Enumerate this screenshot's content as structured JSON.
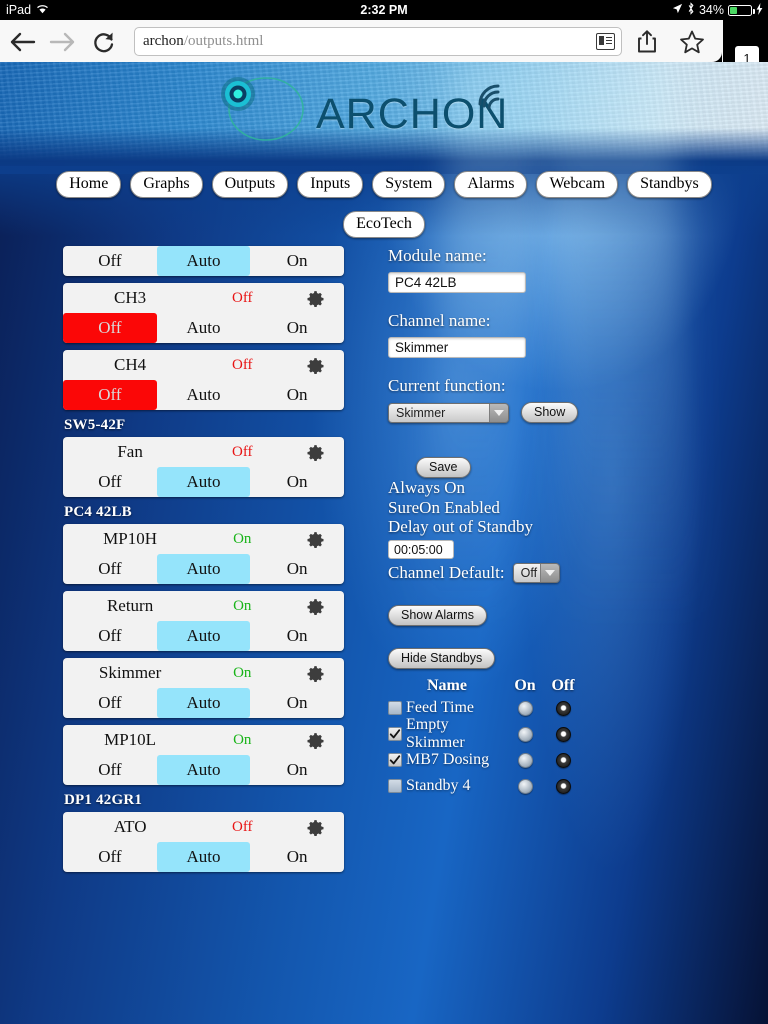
{
  "status_bar": {
    "device": "iPad",
    "wifi_icon": "wifi-icon",
    "time": "2:32 PM",
    "location_icon": "location-arrow-icon",
    "bluetooth_icon": "bluetooth-icon",
    "battery_percent": "34%",
    "battery_fill": 34,
    "charging_icon": "lightning-bolt-icon"
  },
  "browser": {
    "back_icon": "back-arrow-icon",
    "forward_icon": "forward-arrow-icon",
    "reload_icon": "reload-icon",
    "url_host": "archon",
    "url_path": "/outputs.html",
    "reader_icon": "reader-view-icon",
    "share_icon": "share-icon",
    "bookmark_icon": "star-icon",
    "tab_count": "1"
  },
  "header": {
    "logo_text": "ARCHON",
    "logo_mark": "archon-circle-logo-icon",
    "signal_icon": "wifi-arc-icon"
  },
  "nav": {
    "row1": [
      "Home",
      "Graphs",
      "Outputs",
      "Inputs",
      "System",
      "Alarms",
      "Webcam",
      "Standbys"
    ],
    "row2": [
      "EcoTech"
    ]
  },
  "button_labels": {
    "off": "Off",
    "auto": "Auto",
    "on": "On"
  },
  "channels": [
    {
      "group": null,
      "clipped": true,
      "name": "",
      "state": "",
      "state_kind": "",
      "selected": "auto"
    },
    {
      "group": null,
      "clipped": false,
      "name": "CH3",
      "state": "Off",
      "state_kind": "off",
      "selected": "off"
    },
    {
      "group": null,
      "clipped": false,
      "name": "CH4",
      "state": "Off",
      "state_kind": "off",
      "selected": "off"
    },
    {
      "group": "SW5-42F",
      "clipped": false,
      "name": "Fan",
      "state": "Off",
      "state_kind": "off",
      "selected": "auto"
    },
    {
      "group": "PC4 42LB",
      "clipped": false,
      "name": "MP10H",
      "state": "On",
      "state_kind": "on",
      "selected": "auto"
    },
    {
      "group": null,
      "clipped": false,
      "name": "Return",
      "state": "On",
      "state_kind": "on",
      "selected": "auto"
    },
    {
      "group": null,
      "clipped": false,
      "name": "Skimmer",
      "state": "On",
      "state_kind": "on",
      "selected": "auto"
    },
    {
      "group": null,
      "clipped": false,
      "name": "MP10L",
      "state": "On",
      "state_kind": "on",
      "selected": "auto"
    },
    {
      "group": "DP1 42GR1",
      "clipped": false,
      "name": "ATO",
      "state": "Off",
      "state_kind": "off",
      "selected": "auto"
    }
  ],
  "form": {
    "module_name_label": "Module name:",
    "module_name_value": "PC4 42LB",
    "channel_name_label": "Channel name:",
    "channel_name_value": "Skimmer",
    "current_function_label": "Current function:",
    "current_function_value": "Skimmer",
    "show_button": "Show",
    "save_button": "Save",
    "always_on": "Always On",
    "sureon_enabled": "SureOn Enabled",
    "delay_out_of_standby": "Delay out of Standby",
    "delay_value": "00:05:00",
    "channel_default_label": "Channel Default:",
    "channel_default_value": "Off",
    "show_alarms_button": "Show Alarms",
    "hide_standbys_button": "Hide Standbys"
  },
  "standbys": {
    "headers": {
      "name": "Name",
      "on": "On",
      "off": "Off"
    },
    "rows": [
      {
        "name": "Feed Time",
        "checked": false,
        "state": "off"
      },
      {
        "name": "Empty Skimmer",
        "checked": true,
        "state": "off"
      },
      {
        "name": "MB7 Dosing",
        "checked": true,
        "state": "off"
      },
      {
        "name": "Standby 4",
        "checked": false,
        "state": "off"
      }
    ]
  },
  "colors": {
    "auto_selected": "#95e4fb",
    "off_selected": "#fb0707",
    "state_on": "#19b419",
    "state_off": "#e81414",
    "card_bg": "#f2f2f2",
    "battery_green": "#4cd964"
  }
}
